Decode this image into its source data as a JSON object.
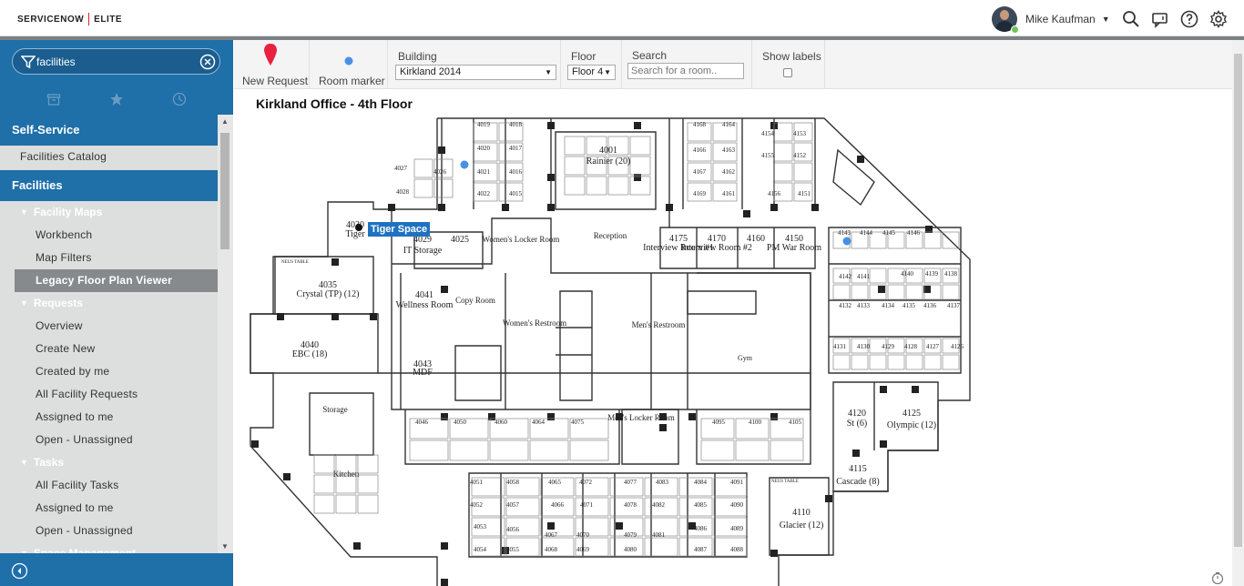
{
  "header": {
    "logo_left": "SERVICENOW",
    "logo_right": "ELITE",
    "user_name": "Mike Kaufman"
  },
  "sidebar": {
    "filter_value": "facilities",
    "nav": {
      "section1": "Self-Service",
      "facilities_catalog": "Facilities Catalog",
      "section2": "Facilities",
      "group_maps": "Facility Maps",
      "workbench": "Workbench",
      "map_filters": "Map Filters",
      "legacy_viewer": "Legacy Floor Plan Viewer",
      "group_requests": "Requests",
      "overview": "Overview",
      "create_new": "Create New",
      "created_by_me": "Created by me",
      "all_facility_requests": "All Facility Requests",
      "assigned_to_me": "Assigned to me",
      "open_unassigned": "Open - Unassigned",
      "group_tasks": "Tasks",
      "all_facility_tasks": "All Facility Tasks",
      "tasks_assigned_to_me": "Assigned to me",
      "tasks_open_unassigned": "Open - Unassigned",
      "group_space": "Space Management"
    }
  },
  "toolbar": {
    "new_request": "New Request",
    "room_marker": "Room marker",
    "building_label": "Building",
    "building_value": "Kirkland 2014",
    "floor_label": "Floor",
    "floor_value": "Floor 4",
    "search_label": "Search",
    "search_placeholder": "Search for a room..",
    "show_labels": "Show labels"
  },
  "map": {
    "title": "Kirkland Office - 4th Floor",
    "tooltip": "Tiger Space",
    "colors": {
      "pin": "#e8213f",
      "marker": "#4a90e2",
      "wall": "#333333"
    },
    "rooms": [
      {
        "id": "rainier",
        "num": "4001",
        "name": "Rainier (20)"
      },
      {
        "id": "tiger",
        "num": "4030",
        "name": "Tiger"
      },
      {
        "id": "crystal",
        "num": "4035",
        "name": "Crystal (TP) (12)"
      },
      {
        "id": "ebc",
        "num": "4040",
        "name": "EBC (18)"
      },
      {
        "id": "storage",
        "num": "",
        "name": "Storage"
      },
      {
        "id": "kitchen",
        "num": "",
        "name": "Kitchen"
      },
      {
        "id": "itstorage",
        "num": "4029",
        "name": "IT Storage"
      },
      {
        "id": "r4025",
        "num": "4025",
        "name": ""
      },
      {
        "id": "womenslocker",
        "num": "",
        "name": "Women's Locker Room"
      },
      {
        "id": "reception",
        "num": "",
        "name": "Reception"
      },
      {
        "id": "interview1",
        "num": "4175",
        "name": "Interview Room #1"
      },
      {
        "id": "interview2",
        "num": "4170",
        "name": "Interview Room #2"
      },
      {
        "id": "r4160",
        "num": "4160",
        "name": ""
      },
      {
        "id": "pmwar",
        "num": "4150",
        "name": "PM War Room"
      },
      {
        "id": "wellness",
        "num": "4041",
        "name": "Wellness Room"
      },
      {
        "id": "copy",
        "num": "",
        "name": "Copy Room"
      },
      {
        "id": "womensrest",
        "num": "",
        "name": "Women's Restroom"
      },
      {
        "id": "mensrest",
        "num": "",
        "name": "Men's Restroom"
      },
      {
        "id": "mdf",
        "num": "4043",
        "name": "MDF"
      },
      {
        "id": "gym",
        "num": "",
        "name": "Gym"
      },
      {
        "id": "menslocker",
        "num": "",
        "name": "Men's Locker Room"
      },
      {
        "id": "r4120",
        "num": "4120",
        "name": "St (6)"
      },
      {
        "id": "olympic",
        "num": "4125",
        "name": "Olympic (12)"
      },
      {
        "id": "cascade",
        "num": "4115",
        "name": "Cascade (8)"
      },
      {
        "id": "glacier",
        "num": "4110",
        "name": "Glacier (12)"
      }
    ],
    "small_labels": [
      "4019",
      "4018",
      "4020",
      "4017",
      "4026",
      "4021",
      "4016",
      "4022",
      "4015",
      "4027",
      "4028",
      "4168",
      "4164",
      "4166",
      "4163",
      "4167",
      "4162",
      "4169",
      "4161",
      "4154",
      "4153",
      "4155",
      "4152",
      "4156",
      "4151",
      "4146",
      "4145",
      "4144",
      "4143",
      "4142",
      "4141",
      "4140",
      "4139",
      "4138",
      "4132",
      "4133",
      "4134",
      "4135",
      "4136",
      "4137",
      "4131",
      "4130",
      "4129",
      "4128",
      "4127",
      "4126",
      "4046",
      "4050",
      "4060",
      "4064",
      "4075",
      "4095",
      "4100",
      "4105",
      "4051",
      "4058",
      "4065",
      "4072",
      "4077",
      "4083",
      "4084",
      "4091",
      "4052",
      "4057",
      "4066",
      "4071",
      "4078",
      "4082",
      "4085",
      "4090",
      "4053",
      "4056",
      "4067",
      "4070",
      "4079",
      "4081",
      "4086",
      "4089",
      "4054",
      "4055",
      "4068",
      "4069",
      "4080",
      "4087",
      "4088"
    ],
    "neus_table": "NEUS TABLE"
  }
}
